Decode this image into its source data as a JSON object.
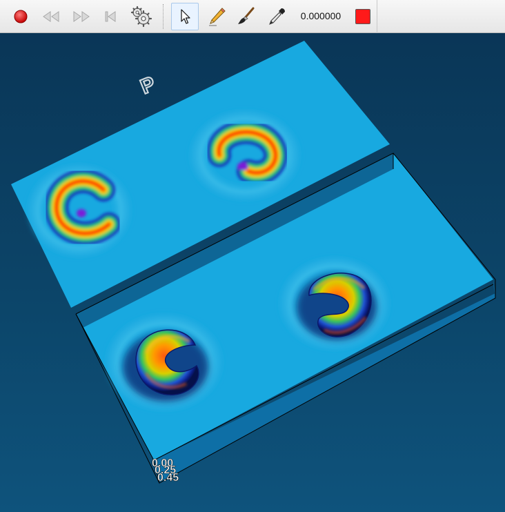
{
  "toolbar": {
    "time_value": "0.000000",
    "color_swatch": "#ff1a1a",
    "buttons": [
      {
        "name": "record-button",
        "icon": "record-icon"
      },
      {
        "name": "rewind-button",
        "icon": "rewind-icon"
      },
      {
        "name": "fast-forward-button",
        "icon": "fast-forward-icon"
      },
      {
        "name": "skip-to-start-button",
        "icon": "skip-start-icon"
      },
      {
        "name": "settings-button",
        "icon": "gears-icon"
      },
      {
        "name": "select-tool-button",
        "icon": "cursor-icon",
        "active": true
      },
      {
        "name": "pencil-tool-button",
        "icon": "pencil-icon"
      },
      {
        "name": "brush-tool-button",
        "icon": "brush-icon"
      },
      {
        "name": "eyedropper-tool-button",
        "icon": "eyedropper-icon"
      }
    ]
  },
  "scene": {
    "plane_label": "P",
    "axis_labels": [
      "0.00",
      "0.25",
      "0.45"
    ],
    "background_colors": [
      "#0a3657",
      "#0e537c"
    ],
    "plane_color": "#18a9e0"
  }
}
